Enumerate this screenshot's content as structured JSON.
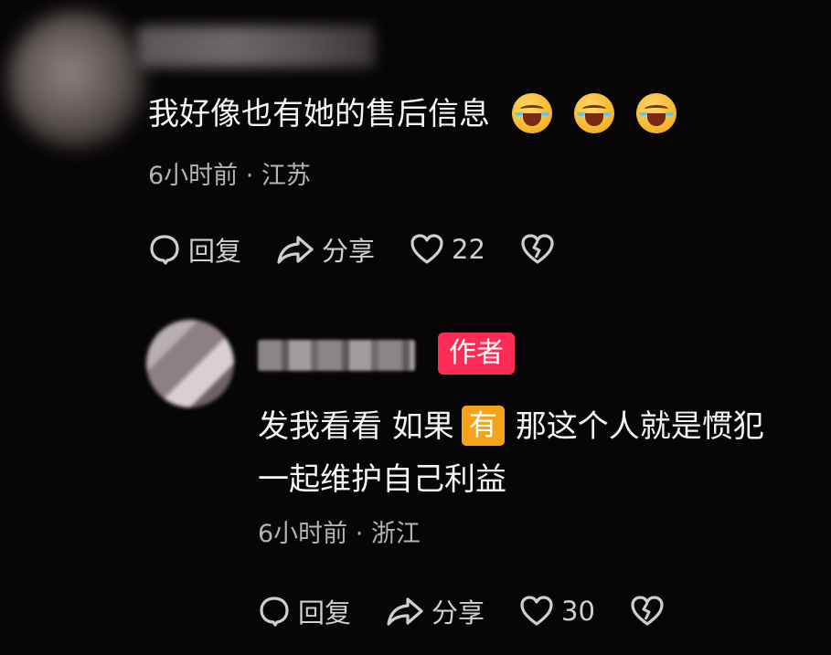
{
  "comment": {
    "text": "我好像也有她的售后信息",
    "emojis": [
      "crying-laughing-emoji",
      "crying-laughing-emoji",
      "crying-laughing-emoji"
    ],
    "meta": "6小时前 · 江苏",
    "actions": {
      "reply": "回复",
      "share": "分享",
      "likes": "22"
    }
  },
  "reply": {
    "author_badge": "作者",
    "text_part1": "发我看看 如果",
    "highlight_word": "有",
    "text_part2": "那这个人就是惯犯",
    "text_line2": "一起维护自己利益",
    "meta": "6小时前 · 浙江",
    "actions": {
      "reply": "回复",
      "share": "分享",
      "likes": "30"
    }
  },
  "colors": {
    "background": "#070506",
    "author_badge": "#fe2c55",
    "word_badge": "#f7a21b",
    "meta_text": "#b3b3b3"
  }
}
